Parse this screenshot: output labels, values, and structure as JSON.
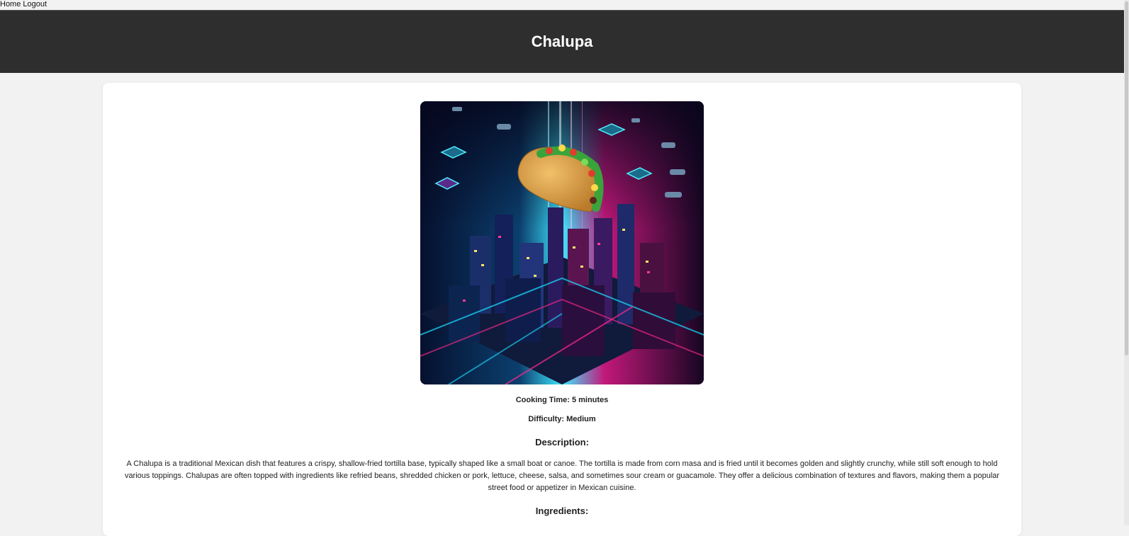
{
  "nav": {
    "home_label": "Home",
    "logout_label": "Logout"
  },
  "header": {
    "title": "Chalupa"
  },
  "recipe": {
    "image_subject": "taco-over-neon-city-illustration",
    "cooking_time": "Cooking Time: 5 minutes",
    "difficulty": "Difficulty: Medium",
    "description_heading": "Description:",
    "description": "A Chalupa is a traditional Mexican dish that features a crispy, shallow-fried tortilla base, typically shaped like a small boat or canoe. The tortilla is made from corn masa and is fried until it becomes golden and slightly crunchy, while still soft enough to hold various toppings. Chalupas are often topped with ingredients like refried beans, shredded chicken or pork, lettuce, cheese, salsa, and sometimes sour cream or guacamole. They offer a delicious combination of textures and flavors, making them a popular street food or appetizer in Mexican cuisine.",
    "ingredients_heading": "Ingredients:"
  },
  "colors": {
    "header_bg": "#2e2e2e",
    "page_bg": "#f2f2f2",
    "card_bg": "#ffffff",
    "neon_cyan": "#19e0ff",
    "neon_pink": "#ff2a8a"
  }
}
